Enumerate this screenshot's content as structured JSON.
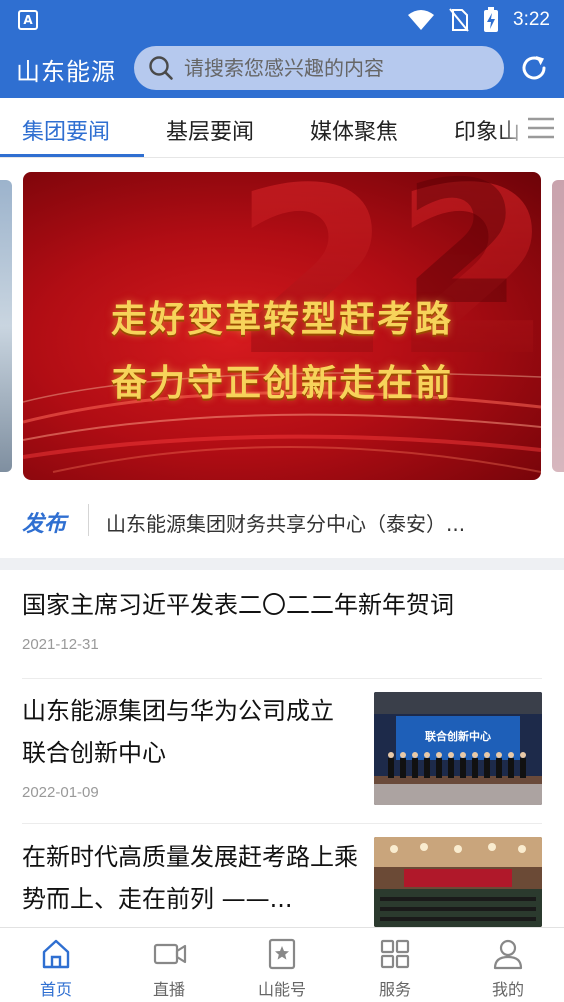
{
  "status_bar": {
    "time": "3:22",
    "app_badge": "A"
  },
  "app_bar": {
    "title": "山东能源",
    "search_placeholder": "请搜索您感兴趣的内容"
  },
  "tabs": [
    {
      "label": "集团要闻",
      "active": true
    },
    {
      "label": "基层要闻",
      "active": false
    },
    {
      "label": "媒体聚焦",
      "active": false
    },
    {
      "label": "印象山",
      "active": false
    }
  ],
  "banner": {
    "line1": "走好变革转型赶考路",
    "line2": "奋力守正创新走在前"
  },
  "notice": {
    "tag": "发布",
    "text": "山东能源集团财务共享分中心（泰安）..."
  },
  "news": [
    {
      "title": "国家主席习近平发表二〇二二年新年贺词",
      "date": "2021-12-31",
      "has_thumb": false
    },
    {
      "title": "山东能源集团与华为公司成立联合创新中心",
      "date": "2022-01-09",
      "has_thumb": true,
      "thumb_text": "联合创新中心"
    },
    {
      "title": "在新时代高质量发展赶考路上乘势而上、走在前列 ——...",
      "date": "",
      "has_thumb": true
    }
  ],
  "bottom_nav": [
    {
      "label": "首页",
      "icon": "home-icon",
      "active": true
    },
    {
      "label": "直播",
      "icon": "video-icon",
      "active": false
    },
    {
      "label": "山能号",
      "icon": "bookmark-star-icon",
      "active": false
    },
    {
      "label": "服务",
      "icon": "grid-icon",
      "active": false
    },
    {
      "label": "我的",
      "icon": "user-icon",
      "active": false
    }
  ],
  "colors": {
    "primary": "#2f6fd1",
    "banner_red": "#c0141a",
    "banner_gold": "#f7d35a"
  }
}
